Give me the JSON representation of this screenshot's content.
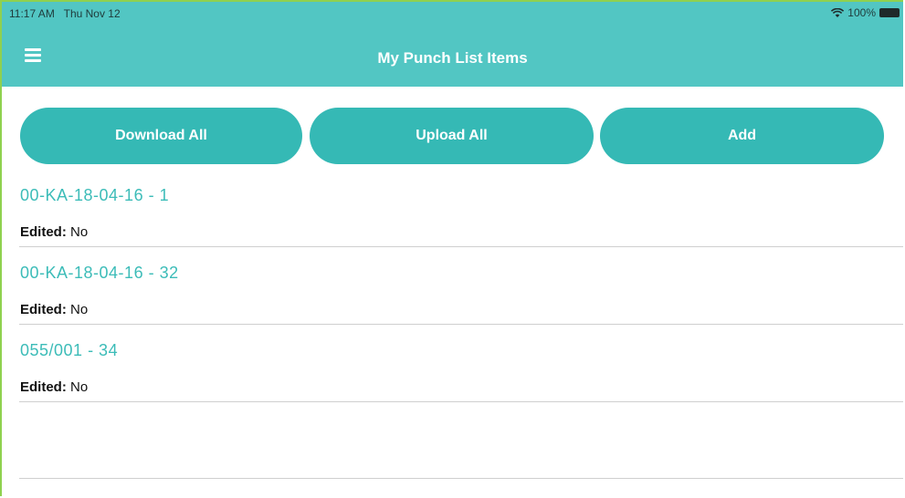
{
  "status": {
    "time": "11:17 AM",
    "date": "Thu Nov 12",
    "battery": "100%"
  },
  "header": {
    "title": "My Punch List Items"
  },
  "actions": {
    "download_all": "Download All",
    "upload_all": "Upload All",
    "add": "Add"
  },
  "items": [
    {
      "title": "00-KA-18-04-16 - 1",
      "edited_label": "Edited:",
      "edited_value": "No"
    },
    {
      "title": "00-KA-18-04-16 - 32",
      "edited_label": "Edited:",
      "edited_value": "No"
    },
    {
      "title": "055/001 - 34",
      "edited_label": "Edited:",
      "edited_value": "No"
    }
  ],
  "colors": {
    "header": "#52c6c3",
    "button": "#35b9b5",
    "item_title": "#3cbcb8"
  }
}
